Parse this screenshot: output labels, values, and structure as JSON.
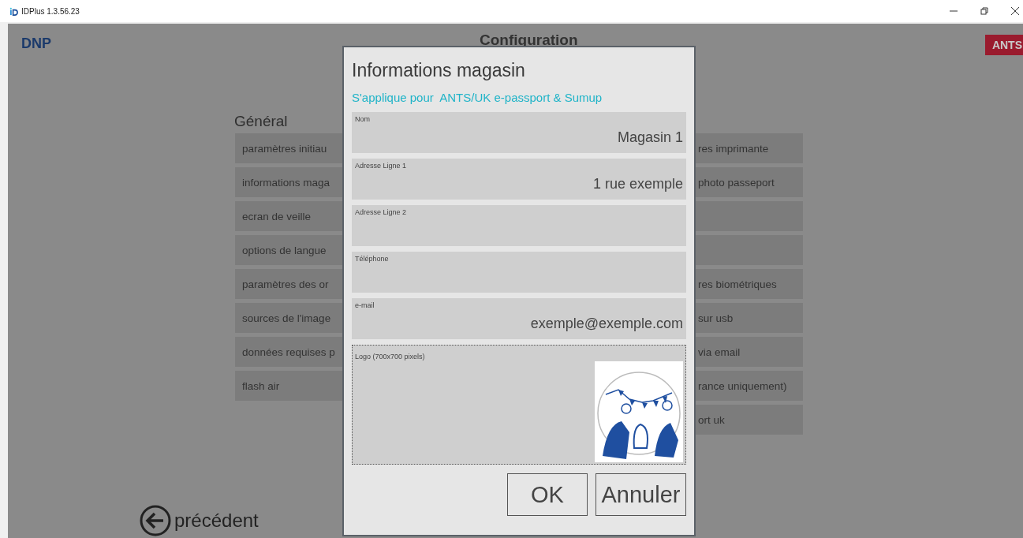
{
  "window": {
    "title": "IDPlus 1.3.56.23"
  },
  "header": {
    "logo": "DNP",
    "title": "Configuration",
    "badge": "ANTS"
  },
  "section_title": "Général",
  "left_items": [
    {
      "label": "paramètres initiau"
    },
    {
      "label": "informations maga"
    },
    {
      "label": "ecran de veille"
    },
    {
      "label": "options de langue"
    },
    {
      "label": "paramètres des or"
    },
    {
      "label": "sources de l'image"
    },
    {
      "label": "données requises p"
    },
    {
      "label": "flash air"
    }
  ],
  "right_items": [
    {
      "kind": "text",
      "label": "res imprimante"
    },
    {
      "kind": "text",
      "label": "photo passeport"
    },
    {
      "kind": "blank"
    },
    {
      "kind": "blank"
    },
    {
      "kind": "text",
      "label": "res biométriques"
    },
    {
      "kind": "text",
      "label": "sur usb"
    },
    {
      "kind": "text",
      "label": "via email"
    },
    {
      "kind": "text",
      "label": "rance uniquement)"
    },
    {
      "kind": "text",
      "label": "ort uk"
    }
  ],
  "back": {
    "label": "précédent"
  },
  "dialog": {
    "title": "Informations magasin",
    "subtitle": "S'applique pour  ANTS/UK e-passport & Sumup",
    "fields": [
      {
        "label": "Nom",
        "value": "Magasin 1"
      },
      {
        "label": "Adresse Ligne 1",
        "value": "1 rue exemple"
      },
      {
        "label": "Adresse Ligne 2"
      },
      {
        "label": "Téléphone"
      },
      {
        "label": "e-mail",
        "value": "exemple@exemple.com"
      }
    ],
    "logo_label": "Logo (700x700 pixels)",
    "buttons": [
      "OK",
      "Annuler"
    ]
  }
}
